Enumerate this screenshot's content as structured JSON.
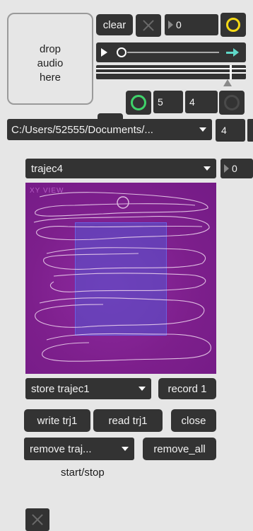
{
  "drop_zone": {
    "label_line1": "drop",
    "label_line2": "audio",
    "label_line3": "here"
  },
  "toolbar": {
    "clear_label": "clear",
    "counter_value": "0"
  },
  "transport": {
    "loop_field_a": "5",
    "loop_field_b": "4"
  },
  "file": {
    "path": "C:/Users/52555/Documents/...",
    "channel_value": "4"
  },
  "trajectory": {
    "selected": "trajec4",
    "selector_value": "0",
    "canvas_label": "XY VIEW",
    "store_selected": "store trajec1",
    "record_label": "record 1",
    "write_label": "write trj1",
    "read_label": "read trj1",
    "close_label": "close",
    "remove_selected": "remove traj...",
    "remove_all_label": "remove_all",
    "startstop_label": "start/stop"
  },
  "colors": {
    "panel_bg": "#e6e6e6",
    "control_bg": "#333333",
    "canvas_bg": "#7d1f8c",
    "selection_rect": "#5a4fc9",
    "yellow_accent": "#f5d916",
    "green_accent": "#3fd36a",
    "arrow_accent": "#5fd8c8"
  },
  "icons": [
    "close-icon",
    "play-icon",
    "arrow-right-icon",
    "circle-icon"
  ]
}
